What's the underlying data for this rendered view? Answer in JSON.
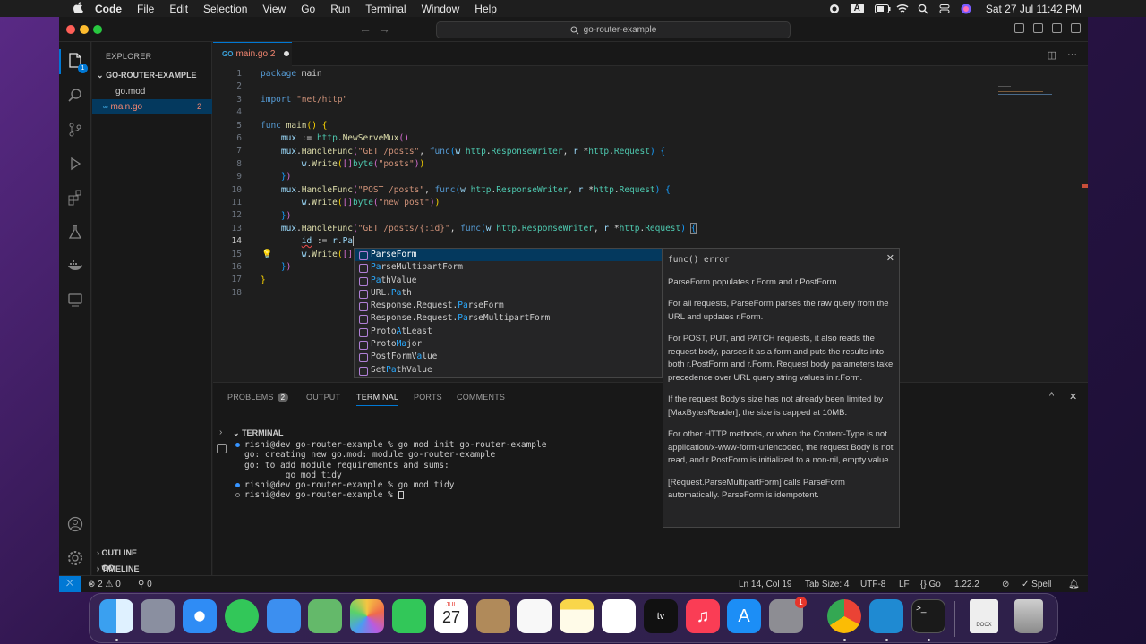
{
  "menubar": {
    "app": "Code",
    "items": [
      "File",
      "Edit",
      "Selection",
      "View",
      "Go",
      "Run",
      "Terminal",
      "Window",
      "Help"
    ],
    "input_indicator": "A",
    "clock": "Sat 27 Jul  11:42 PM"
  },
  "titlebar": {
    "search": "go-router-example"
  },
  "sidebar": {
    "title": "EXPLORER",
    "folder": "GO-ROUTER-EXAMPLE",
    "files": [
      {
        "name": "go.mod"
      },
      {
        "name": "main.go",
        "count": "2"
      }
    ],
    "outline": "OUTLINE",
    "timeline": "TIMELINE",
    "go": "GO"
  },
  "activity": {
    "explorer_badge": "1"
  },
  "tab": {
    "icon": "GO",
    "label": "main.go",
    "count": "2"
  },
  "editor": {
    "line_numbers": [
      "1",
      "2",
      "3",
      "4",
      "5",
      "6",
      "7",
      "8",
      "9",
      "10",
      "11",
      "12",
      "13",
      "14",
      "15",
      "16",
      "17",
      "18"
    ],
    "current_line": "14"
  },
  "suggest": {
    "items": [
      {
        "pre": "",
        "hl": "Pa",
        "post": "rseForm"
      },
      {
        "pre": "",
        "hl": "Pa",
        "post": "rseMultipartForm"
      },
      {
        "pre": "",
        "hl": "Pa",
        "post": "thValue"
      },
      {
        "pre": "URL.",
        "hl": "Pa",
        "post": "th"
      },
      {
        "pre": "Response.Request.",
        "hl": "Pa",
        "post": "rseForm"
      },
      {
        "pre": "Response.Request.",
        "hl": "Pa",
        "post": "rseMultipartForm"
      },
      {
        "pre": "Proto",
        "hl": "A",
        "post": "tLeast"
      },
      {
        "pre": "Proto",
        "hl": "Ma",
        "post": "jor"
      },
      {
        "pre": "PostFormV",
        "hl": "a",
        "post": "lue"
      },
      {
        "pre": "Set",
        "hl": "Pa",
        "post": "thValue"
      }
    ],
    "detail": {
      "signature": "func() error",
      "paragraphs": [
        "ParseForm populates r.Form and r.PostForm.",
        "For all requests, ParseForm parses the raw query from the URL and updates r.Form.",
        "For POST, PUT, and PATCH requests, it also reads the request body, parses it as a form and puts the results into both r.PostForm and r.Form. Request body parameters take precedence over URL query string values in r.Form.",
        "If the request Body's size has not already been limited by [MaxBytesReader], the size is capped at 10MB.",
        "For other HTTP methods, or when the Content-Type is not application/x-www-form-urlencoded, the request Body is not read, and r.PostForm is initialized to a non-nil, empty value.",
        "[Request.ParseMultipartForm] calls ParseForm automatically. ParseForm is idempotent."
      ]
    }
  },
  "panel": {
    "tabs": {
      "problems": "PROBLEMS",
      "problems_count": "2",
      "output": "OUTPUT",
      "terminal": "TERMINAL",
      "ports": "PORTS",
      "comments": "COMMENTS"
    },
    "terminal_title": "TERMINAL",
    "lines": [
      {
        "mark": "blue",
        "text": "rishi@dev go-router-example % go mod init go-router-example"
      },
      {
        "mark": "",
        "text": "go: creating new go.mod: module go-router-example"
      },
      {
        "mark": "",
        "text": "go: to add module requirements and sums:"
      },
      {
        "mark": "",
        "text": "        go mod tidy"
      },
      {
        "mark": "blue",
        "text": "rishi@dev go-router-example % go mod tidy"
      },
      {
        "mark": "empty",
        "text": "rishi@dev go-router-example % "
      }
    ]
  },
  "statusbar": {
    "errors": "2",
    "warnings": "0",
    "ports": "0",
    "position": "Ln 14, Col 19",
    "tabsize": "Tab Size: 4",
    "encoding": "UTF-8",
    "eol": "LF",
    "language": "Go",
    "goversion": "1.22.2",
    "spell": "Spell"
  },
  "dock": {
    "calendar_month": "JUL",
    "calendar_day": "27",
    "settings_badge": "1",
    "docx_label": "DOCX"
  }
}
